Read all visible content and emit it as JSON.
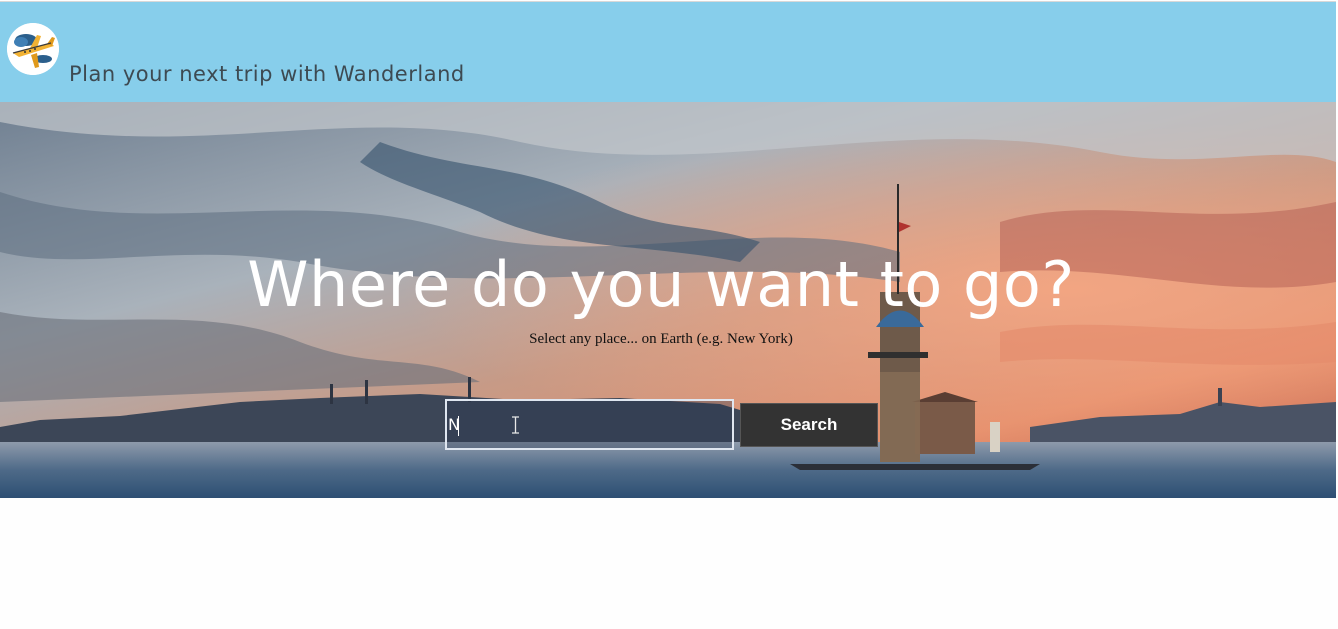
{
  "header": {
    "logo_icon": "airplane-cloud-logo",
    "tagline": "Plan your next trip with Wanderland",
    "background_color": "#87ceeb"
  },
  "hero": {
    "background": "istanbul-maiden-tower-sunset",
    "headline": "Where do you want to go?",
    "subtext": "Select any place... on Earth (e.g. New York)"
  },
  "search": {
    "value": "N",
    "button_label": "Search"
  }
}
